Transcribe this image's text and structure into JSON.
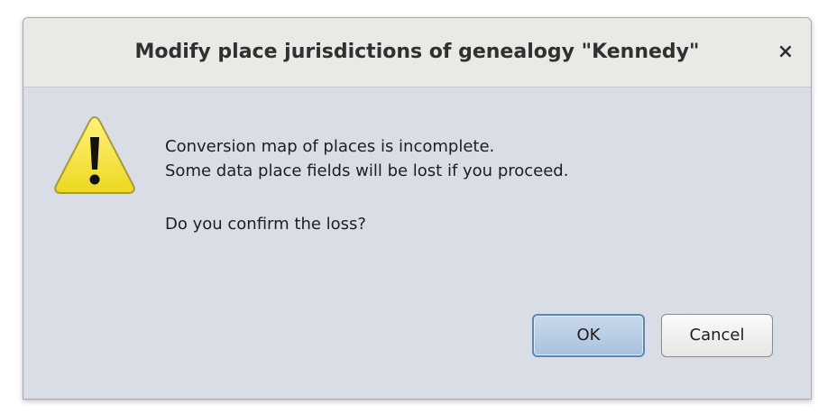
{
  "dialog": {
    "title": "Modify place jurisdictions of genealogy \"Kennedy\"",
    "close_glyph": "×",
    "icon": "warning-icon",
    "message_lines": [
      "Conversion map of places is incomplete.",
      "Some data place fields will be lost if you proceed."
    ],
    "question": "Do you confirm the loss?",
    "ok_label": "OK",
    "cancel_label": "Cancel"
  },
  "colors": {
    "titlebar": "#ebe9e6",
    "body": "#d8dde6",
    "warning_fill": "#f5e63a",
    "ok_border": "#5a86b8"
  }
}
